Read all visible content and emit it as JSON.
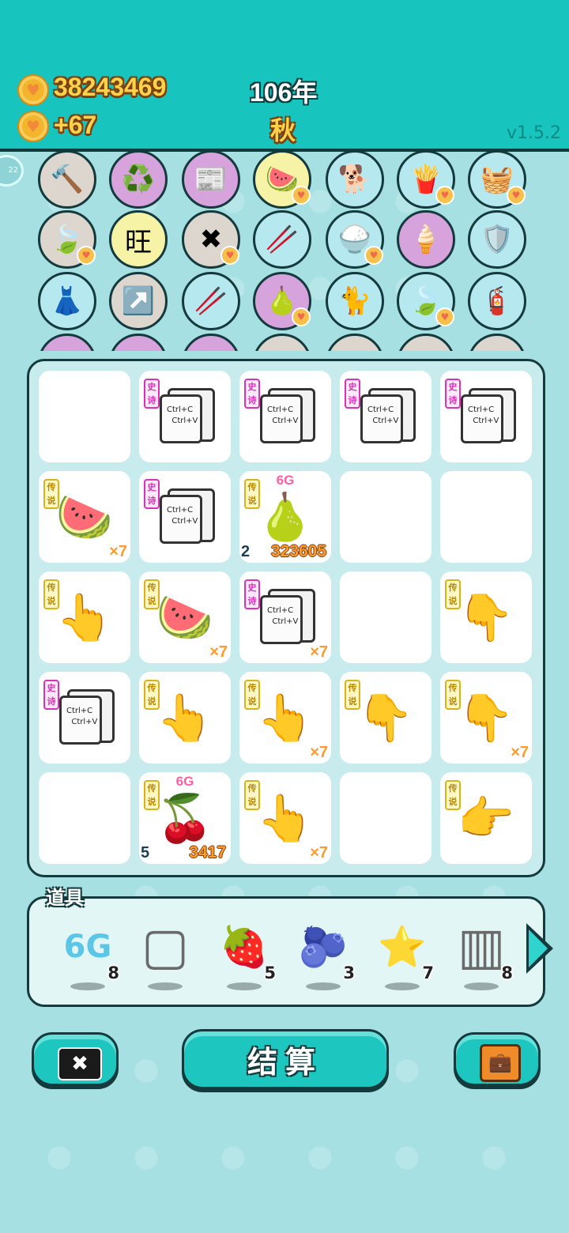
{
  "header": {
    "coins": "38243469",
    "income": "+67",
    "year": "106年",
    "season": "秋",
    "version": "v1.5.2"
  },
  "side_badge": "22",
  "items_rows": [
    [
      {
        "icon": "hammer-icon",
        "glyph": "🔨",
        "bg": "grey"
      },
      {
        "icon": "recycle-icon",
        "glyph": "♻️",
        "bg": "purple"
      },
      {
        "icon": "time-magazine-icon",
        "glyph": "📰",
        "bg": "purple"
      },
      {
        "icon": "fruit-platter-icon",
        "glyph": "🍉",
        "bg": "yellow"
      },
      {
        "icon": "dog-icon",
        "glyph": "🐕",
        "bg": "cyan"
      },
      {
        "icon": "fries-icon",
        "glyph": "🍟",
        "bg": "cyan"
      },
      {
        "icon": "fruit-basket-icon",
        "glyph": "🧺",
        "bg": "cyan"
      }
    ],
    [
      {
        "icon": "leaf-icon",
        "glyph": "🍃",
        "bg": "grey"
      },
      {
        "icon": "wang-tiles-icon",
        "glyph": "旺",
        "bg": "yellow"
      },
      {
        "icon": "close-tag-icon",
        "glyph": "✖",
        "bg": "grey"
      },
      {
        "icon": "chopsticks-icon",
        "glyph": "🥢",
        "bg": "cyan"
      },
      {
        "icon": "rice-bowl-icon",
        "glyph": "🍚",
        "bg": "cyan"
      },
      {
        "icon": "ice-cream-icon",
        "glyph": "🍦",
        "bg": "purple"
      },
      {
        "icon": "shield-wrench-icon",
        "glyph": "🛡️",
        "bg": "cyan"
      }
    ],
    [
      {
        "icon": "skirt-icon",
        "glyph": "👗",
        "bg": "cyan"
      },
      {
        "icon": "arrow-card-icon",
        "glyph": "↗️",
        "bg": "grey"
      },
      {
        "icon": "chopsticks-icon",
        "glyph": "🥢",
        "bg": "cyan"
      },
      {
        "icon": "grapefruit-icon",
        "glyph": "🍐",
        "bg": "purple"
      },
      {
        "icon": "cat-icon",
        "glyph": "🐈",
        "bg": "cyan"
      },
      {
        "icon": "leaf-icon",
        "glyph": "🍃",
        "bg": "cyan"
      },
      {
        "icon": "pump-icon",
        "glyph": "🧯",
        "bg": "cyan"
      }
    ]
  ],
  "board": [
    [
      {
        "type": "empty"
      },
      {
        "type": "ctrl",
        "tag": "史诗"
      },
      {
        "type": "ctrl",
        "tag": "史诗"
      },
      {
        "type": "ctrl",
        "tag": "史诗"
      },
      {
        "type": "ctrl",
        "tag": "史诗"
      }
    ],
    [
      {
        "type": "big",
        "tag": "传说",
        "icon": "watermelon-icon",
        "glyph": "🍉",
        "mult": "×7"
      },
      {
        "type": "ctrl",
        "tag": "史诗"
      },
      {
        "type": "big",
        "tag": "传说",
        "icon": "pomelo-icon",
        "glyph": "🍐",
        "g6": "6G",
        "lvl": "2",
        "score": "323605"
      },
      {
        "type": "empty"
      },
      {
        "type": "empty"
      }
    ],
    [
      {
        "type": "big",
        "tag": "传说",
        "icon": "pointing-up-hand-icon",
        "glyph": "👆"
      },
      {
        "type": "big",
        "tag": "传说",
        "icon": "watermelon-icon",
        "glyph": "🍉",
        "mult": "×7"
      },
      {
        "type": "ctrl",
        "tag": "史诗",
        "mult": "×7"
      },
      {
        "type": "empty"
      },
      {
        "type": "big",
        "tag": "传说",
        "icon": "pointing-down-hand-icon",
        "glyph": "👇"
      }
    ],
    [
      {
        "type": "ctrl",
        "tag": "史诗"
      },
      {
        "type": "big",
        "tag": "传说",
        "icon": "pointing-up-hand-icon",
        "glyph": "👆"
      },
      {
        "type": "big",
        "tag": "传说",
        "icon": "pointing-up-hand-icon",
        "glyph": "👆",
        "mult": "×7"
      },
      {
        "type": "big",
        "tag": "传说",
        "icon": "pointing-down-left-hand-icon",
        "glyph": "👇"
      },
      {
        "type": "big",
        "tag": "传说",
        "icon": "pointing-down-right-hand-icon",
        "glyph": "👇",
        "mult": "×7"
      }
    ],
    [
      {
        "type": "empty"
      },
      {
        "type": "big",
        "tag": "传说",
        "icon": "longan-icon",
        "glyph": "🍒",
        "g6": "6G",
        "lvl": "5",
        "score": "3417"
      },
      {
        "type": "big",
        "tag": "传说",
        "icon": "pointing-up-hand-icon",
        "glyph": "👆",
        "mult": "×7"
      },
      {
        "type": "empty"
      },
      {
        "type": "big",
        "tag": "传说",
        "icon": "pointing-right-hand-icon",
        "glyph": "👉"
      }
    ]
  ],
  "ctrl_text": {
    "line1": "Ctrl+C",
    "line2": "Ctrl+V"
  },
  "props": {
    "label": "道具",
    "items": [
      {
        "icon": "6g-icon",
        "glyph": "6G",
        "count": "8"
      },
      {
        "icon": "frame-icon",
        "glyph": "▢",
        "count": ""
      },
      {
        "icon": "strawberry-icon",
        "glyph": "🍓",
        "count": "5"
      },
      {
        "icon": "blueberry-icon",
        "glyph": "🫐",
        "count": "3"
      },
      {
        "icon": "star-icon",
        "glyph": "⭐",
        "count": "7"
      },
      {
        "icon": "battery-icon",
        "glyph": "▥",
        "count": "8"
      }
    ]
  },
  "buttons": {
    "settle": "结算"
  }
}
